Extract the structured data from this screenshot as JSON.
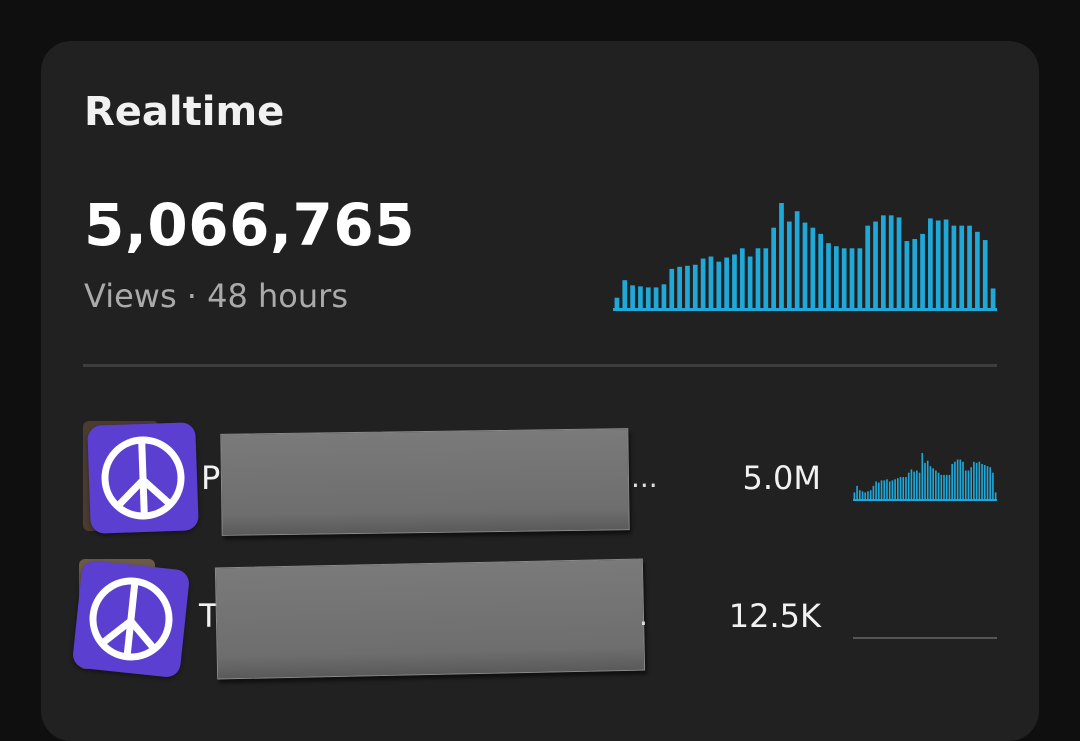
{
  "card": {
    "title": "Realtime",
    "total_views": "5,066,765",
    "subtitle": "Views · 48 hours"
  },
  "accent_color": "#20a8d8",
  "main_chart": {
    "type": "bar",
    "values": [
      10,
      27,
      22,
      21,
      20,
      20,
      23,
      38,
      40,
      41,
      42,
      48,
      50,
      45,
      49,
      52,
      58,
      50,
      58,
      58,
      78,
      102,
      84,
      94,
      83,
      78,
      72,
      63,
      60,
      58,
      58,
      58,
      80,
      84,
      90,
      90,
      88,
      65,
      67,
      72,
      87,
      85,
      86,
      80,
      80,
      80,
      74,
      66,
      19
    ]
  },
  "rows": [
    {
      "thumbnail_icon": "peace-sign-icon",
      "title_visible": "P",
      "title_suffix": "...",
      "value": "5.0M",
      "spark": [
        6,
        12,
        8,
        7,
        6,
        7,
        8,
        12,
        16,
        15,
        17,
        17,
        18,
        16,
        17,
        18,
        19,
        20,
        20,
        20,
        24,
        27,
        25,
        26,
        24,
        42,
        33,
        35,
        30,
        28,
        26,
        24,
        22,
        22,
        22,
        22,
        32,
        34,
        36,
        36,
        34,
        26,
        26,
        29,
        34,
        33,
        34,
        32,
        31,
        30,
        29,
        24,
        6
      ]
    },
    {
      "thumbnail_icon": "peace-sign-icon",
      "title_visible": "T",
      "title_suffix": ".",
      "value": "12.5K",
      "spark": []
    }
  ]
}
